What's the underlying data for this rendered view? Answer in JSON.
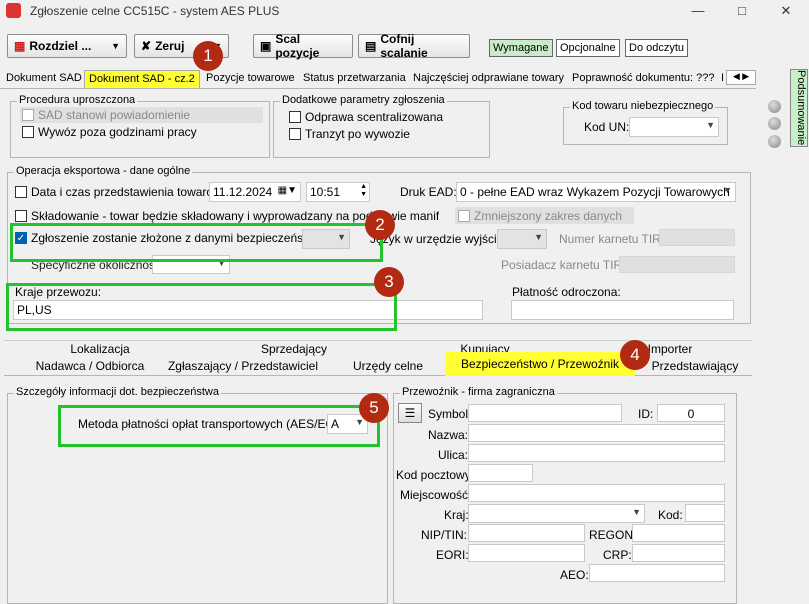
{
  "window": {
    "title": "Zgłoszenie celne CC515C - system AES PLUS"
  },
  "toolbar": {
    "rozdziel": "Rozdziel ...",
    "zeruj": "Zeruj",
    "scal": "Scal pozycje",
    "cofnij": "Cofnij scalanie",
    "toggles": [
      "Wymagane",
      "Opcjonalne",
      "Do odczytu"
    ]
  },
  "tabs": [
    "Dokument SAD",
    "Dokument SAD - cz.2",
    "Pozycje towarowe",
    "Status przetwarzania",
    "Najczęściej odprawiane towary",
    "Poprawność dokumentu: ???",
    "I"
  ],
  "side": {
    "label": "Podsumowanie"
  },
  "procedura": {
    "title": "Procedura uproszczona",
    "sad": "SAD stanowi powiadomienie",
    "wywoz": "Wywóz poza godzinami pracy"
  },
  "dodatkowe": {
    "title": "Dodatkowe parametry zgłoszenia",
    "odprawa": "Odprawa scentralizowana",
    "tranzyt": "Tranzyt po wywozie"
  },
  "niebezp": {
    "title": "Kod towaru niebezpiecznego",
    "kod_un": "Kod UN:"
  },
  "operacja": {
    "title": "Operacja eksportowa - dane ogólne",
    "data_label": "Data i czas przedstawienia towarów:",
    "date": "11.12.2024",
    "time": "10:51",
    "druk_label": "Druk EAD:",
    "druk_value": "0 - pełne EAD wraz Wykazem Pozycji Towarowych",
    "skladowanie": "Składowanie - towar będzie składowany i wyprowadzany na podstawie manifestu(ów)",
    "zmniejszony": "Zmniejszony zakres danych",
    "bezpieczenstwo": "Zgłoszenie zostanie złożone z danymi bezpieczeństwa",
    "jezyk": "Język w urzędzie wyjścia:",
    "karnet": "Numer karnetu TIR:",
    "specyficzne": "Specyficzne okoliczności:",
    "posiadacz": "Posiadacz karnetu TIR:",
    "kraje_label": "Kraje przewozu:",
    "kraje_value": "PL,US",
    "platnosc": "Płatność odroczona:"
  },
  "subtabs_top": [
    "Lokalizacja",
    "Sprzedający",
    "Kupujący",
    "Importer"
  ],
  "subtabs_bottom": [
    "Nadawca / Odbiorca",
    "Zgłaszający / Przedstawiciel",
    "Urzędy celne",
    "Bezpieczeństwo / Przewoźnik",
    "Przedstawiający"
  ],
  "szczegoly": {
    "title": "Szczegóły informacji dot. bezpieczeństwa",
    "metoda_label": "Metoda płatności opłat transportowych (AES/ECS):",
    "metoda_value": "A"
  },
  "przewoznik": {
    "title": "Przewoźnik - firma zagraniczna",
    "symbol": "Symbol:",
    "id": "ID:",
    "id_value": "0",
    "nazwa": "Nazwa:",
    "ulica": "Ulica:",
    "kod": "Kod pocztowy:",
    "miejscowosc": "Miejscowość:",
    "kraj": "Kraj:",
    "kod2": "Kod:",
    "nip": "NIP/TIN:",
    "regon": "REGON",
    "eori": "EORI:",
    "crp": "CRP:",
    "aeo": "AEO:"
  },
  "badges": [
    "1",
    "2",
    "3",
    "4",
    "5"
  ],
  "colors": {
    "highlight": "#ffff33",
    "annotation": "#22c32e",
    "badge": "#b22a12"
  }
}
